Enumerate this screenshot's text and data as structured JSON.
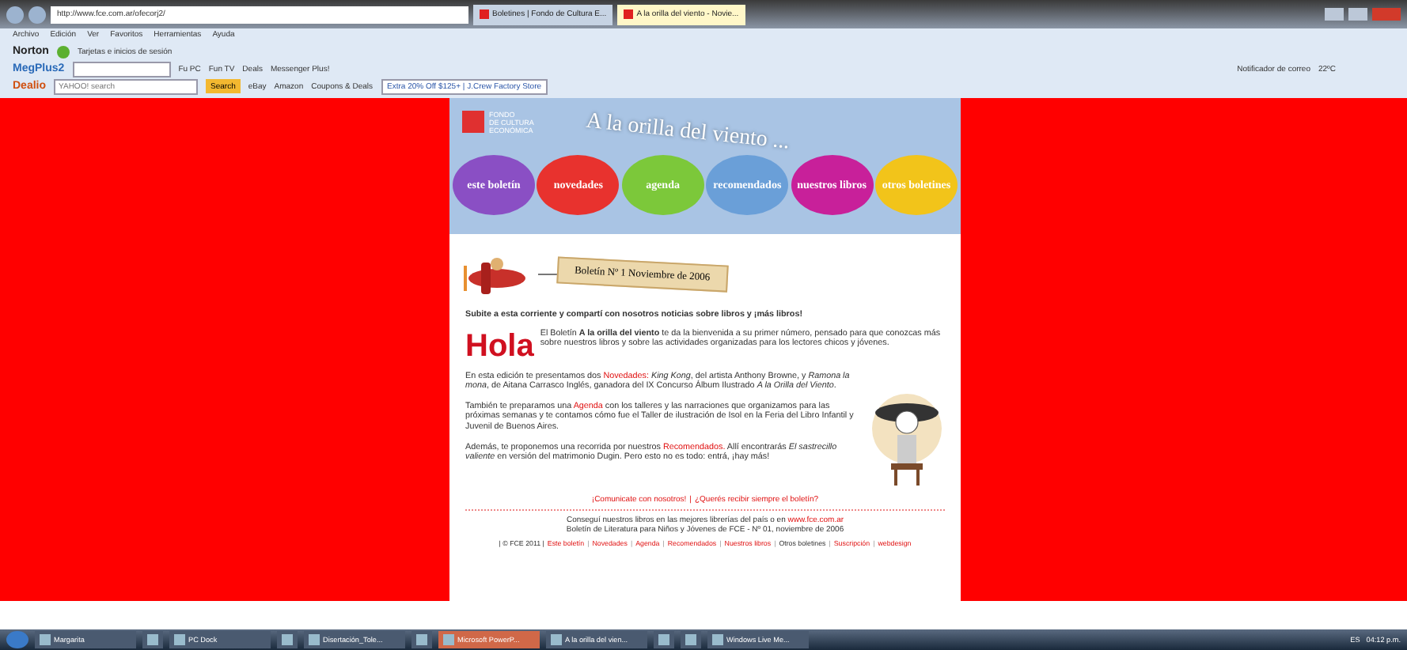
{
  "browser": {
    "address": "http://www.fce.com.ar/ofecorj2/",
    "tabs": [
      {
        "label": "Boletines | Fondo de Cultura E...",
        "selected": false
      },
      {
        "label": "A la orilla del viento - Novie...",
        "selected": true
      }
    ],
    "menu": [
      "Archivo",
      "Edición",
      "Ver",
      "Favoritos",
      "Herramientas",
      "Ayuda"
    ],
    "norton_bar": {
      "brand": "Norton",
      "item": "Tarjetas e inicios de sesión"
    },
    "plus_bar": {
      "brand": "MegPlus2",
      "items": [
        "Fu PC",
        "Fun TV",
        "Deals",
        "Messenger Plus!"
      ],
      "notifier": "Notificador de correo",
      "weather": "22ºC"
    },
    "dealio_bar": {
      "brand": "Dealio",
      "search_placeholder": "YAHOO! search",
      "search_button": "Search",
      "links": [
        "eBay",
        "Amazon",
        "Coupons & Deals"
      ],
      "promo": "Extra 20% Off $125+ | J.Crew Factory Store"
    }
  },
  "page": {
    "logo": [
      "FONDO",
      "DE CULTURA",
      "ECONÓMICA"
    ],
    "headline": "A la orilla del viento ...",
    "balloons": [
      {
        "label": "este boletín",
        "color": "#8a4fc4"
      },
      {
        "label": "novedades",
        "color": "#e8322e"
      },
      {
        "label": "agenda",
        "color": "#7cc83a"
      },
      {
        "label": "recomendados",
        "color": "#6a9fd8"
      },
      {
        "label": "nuestros libros",
        "color": "#c8209a"
      },
      {
        "label": "otros boletines",
        "color": "#f2c41a"
      }
    ],
    "banner": "Boletín Nº 1 Noviembre de 2006",
    "intro": "Subite a esta corriente y compartí con nosotros noticias sobre libros y ¡más libros!",
    "greeting": "Hola",
    "paragraphs": [
      [
        {
          "kind": "text",
          "text": "El Boletín **A la orilla del viento** te da la bienvenida a su primer número, pensado para que conozcas más sobre nuestros libros y sobre las actividades organizadas para los lectores chicos y jóvenes."
        }
      ],
      [
        {
          "kind": "text",
          "text": "En esta edición te presentamos dos"
        },
        {
          "kind": "link",
          "text": "Novedades:"
        },
        {
          "kind": "text",
          "text": "*King Kong*, del artista Anthony Browne, y *Ramona la mona*, de Aitana Carrasco Inglés, ganadora del IX Concurso Álbum Ilustrado *A la Orilla del Viento*."
        }
      ],
      [
        {
          "kind": "text",
          "text": "También te preparamos una"
        },
        {
          "kind": "link",
          "text": "Agenda"
        },
        {
          "kind": "text",
          "text": "con los talleres y las narraciones que organizamos para las próximas semanas y te contamos cómo fue el Taller de ilustración de Isol en la Feria del Libro Infantil y Juvenil de Buenos Aires."
        }
      ],
      [
        {
          "kind": "text",
          "text": "Además, te proponemos una recorrida por nuestros"
        },
        {
          "kind": "link",
          "text": "Recomendados."
        },
        {
          "kind": "text",
          "text": "Allí encontrarás *El sastrecillo valiente* en versión del matrimonio Dugin. Pero esto no es todo: entrá, ¡hay más!"
        }
      ]
    ],
    "contact_links": [
      "¡Comunicate con nosotros!",
      "|",
      "¿Querés recibir siempre el boletín?"
    ],
    "footer_lines": [
      [
        {
          "kind": "text",
          "text": "Conseguí nuestros libros en las mejores librerías del país o en"
        },
        {
          "kind": "link",
          "text": "www.fce.com.ar"
        }
      ],
      [
        {
          "kind": "text",
          "text": "Boletín de Literatura para Niños y Jóvenes de FCE - Nº 01, noviembre de 2006"
        }
      ]
    ],
    "nav_copyright": "| © FCE 2011 |",
    "nav": [
      {
        "label": "Este boletín",
        "kind": "link"
      },
      {
        "label": "|",
        "kind": "separator"
      },
      {
        "label": "Novedades",
        "kind": "link"
      },
      {
        "label": "|",
        "kind": "separator"
      },
      {
        "label": "Agenda",
        "kind": "link"
      },
      {
        "label": "|",
        "kind": "separator"
      },
      {
        "label": "Recomendados",
        "kind": "link"
      },
      {
        "label": "|",
        "kind": "separator"
      },
      {
        "label": "Nuestros libros",
        "kind": "link"
      },
      {
        "label": "|",
        "kind": "separator"
      },
      {
        "label": "Otros boletines",
        "kind": "text"
      },
      {
        "label": "|",
        "kind": "separator"
      },
      {
        "label": "Suscripción",
        "kind": "link"
      },
      {
        "label": "|",
        "kind": "separator"
      },
      {
        "label": "webdesign",
        "kind": "link"
      }
    ]
  },
  "taskbar": {
    "items": [
      {
        "label": "Margarita",
        "selected": false
      },
      {
        "selected": false
      },
      {
        "label": "PC Dock",
        "selected": false
      },
      {
        "selected": false
      },
      {
        "label": "Disertación_Tole...",
        "selected": false
      },
      {
        "selected": false
      },
      {
        "label": "Microsoft PowerP...",
        "selected": true
      },
      {
        "label": "A la orilla del vien...",
        "selected": false
      },
      {
        "selected": false
      },
      {
        "selected": false
      },
      {
        "label": "Windows Live Me...",
        "selected": false
      }
    ],
    "language": "ES",
    "time": "04:12 p.m."
  }
}
